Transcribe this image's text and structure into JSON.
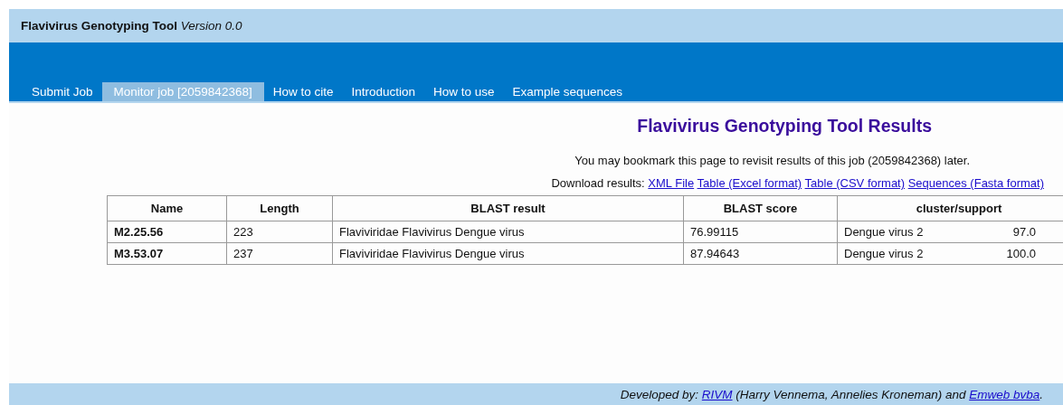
{
  "header": {
    "title": "Flavivirus Genotyping Tool",
    "version": "Version 0.0"
  },
  "tabs": [
    {
      "label": "Submit Job",
      "selected": false
    },
    {
      "label": "Monitor job [2059842368]",
      "selected": true
    },
    {
      "label": "How to cite",
      "selected": false
    },
    {
      "label": "Introduction",
      "selected": false
    },
    {
      "label": "How to use",
      "selected": false
    },
    {
      "label": "Example sequences",
      "selected": false
    }
  ],
  "heading": "Flavivirus Genotyping Tool Results",
  "note": "You may bookmark this page to revisit results of this job (2059842368) later.",
  "downloads": {
    "label": "Download results:",
    "links": [
      "XML File",
      "Table (Excel format)",
      "Table (CSV format)",
      "Sequences (Fasta format)"
    ]
  },
  "table": {
    "columns": [
      "Name",
      "Length",
      "BLAST result",
      "BLAST score",
      "cluster/support"
    ],
    "rows": [
      {
        "name": "M2.25.56",
        "length": "223",
        "blast_result": "Flaviviridae Flavivirus Dengue virus",
        "blast_score": "76.99115",
        "cluster": "Dengue virus 2",
        "support": "97.0"
      },
      {
        "name": "M3.53.07",
        "length": "237",
        "blast_result": "Flaviviridae Flavivirus Dengue virus",
        "blast_score": "87.94643",
        "cluster": "Dengue virus 2",
        "support": "100.0"
      }
    ]
  },
  "footer": {
    "parts": [
      {
        "kind": "text",
        "text": "Developed by: "
      },
      {
        "kind": "link",
        "text": "RIVM"
      },
      {
        "kind": "text",
        "text": " (Harry Vennema, Annelies Kroneman) and "
      },
      {
        "kind": "link",
        "text": "Emweb bvba"
      },
      {
        "kind": "text",
        "text": "."
      }
    ]
  }
}
